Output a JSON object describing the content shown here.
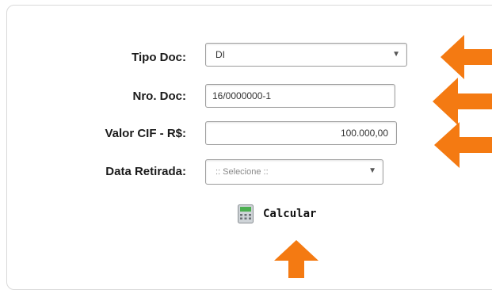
{
  "form": {
    "tipo_doc": {
      "label": "Tipo Doc:",
      "value": "DI"
    },
    "nro_doc": {
      "label": "Nro. Doc:",
      "value": "16/0000000-1"
    },
    "valor_cif": {
      "label": "Valor CIF - R$:",
      "value": "100.000,00"
    },
    "data_retirada": {
      "label": "Data Retirada:",
      "value": ":: Selecione ::"
    }
  },
  "actions": {
    "calcular_label": "Calcular"
  },
  "icons": {
    "select_caret": "chevron-down-icon",
    "calculator": "calculator-icon",
    "annotation_arrow": "arrow-icon"
  },
  "colors": {
    "arrow": "#f47a12",
    "border": "#9e9e9e",
    "calculator_screen": "#4caf50"
  }
}
